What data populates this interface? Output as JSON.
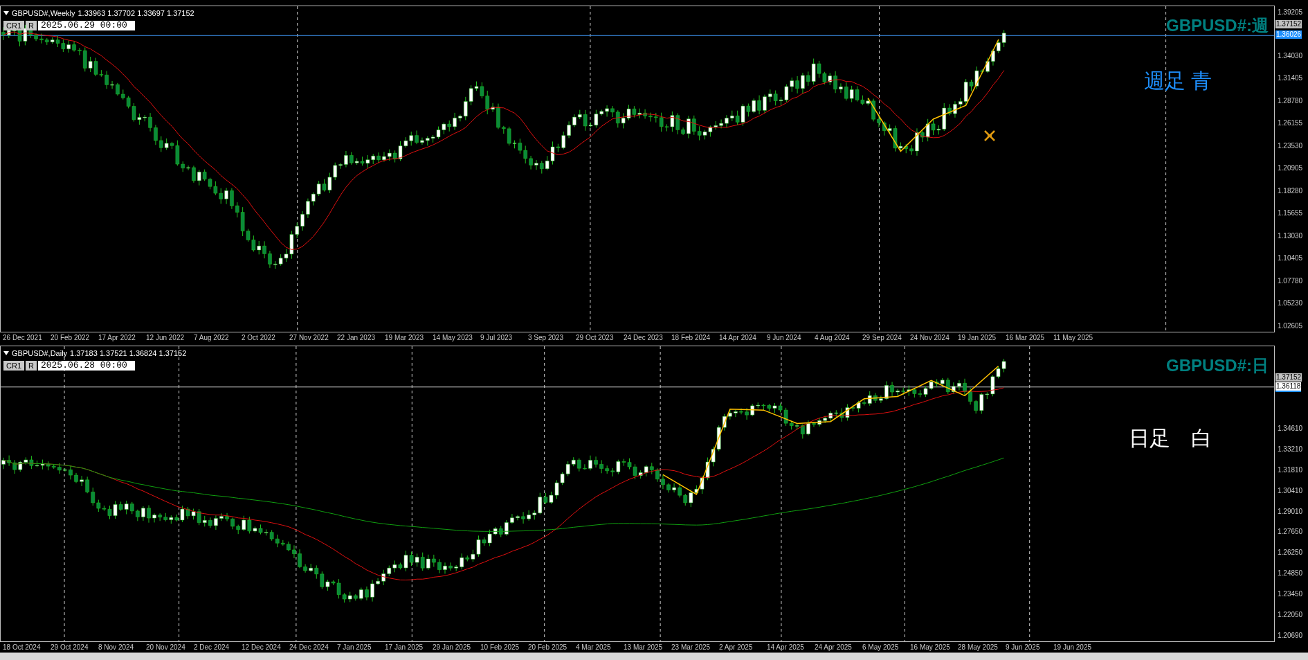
{
  "charts": [
    {
      "symbol": "GBPUSD#,Weekly",
      "ohlc": "1.33963 1.37702 1.33697 1.37152",
      "buttons": [
        "CR1",
        "R"
      ],
      "time_field": "2025.06.29 00:00",
      "label": "GBPUSD#:週",
      "note": {
        "text": "週足 青",
        "color": "#1e90ff"
      },
      "kind": "weekly",
      "price_axis": [
        "1.39205",
        "1.34030",
        "1.31405",
        "1.28780",
        "1.26155",
        "1.23530",
        "1.20905",
        "1.18280",
        "1.15655",
        "1.13030",
        "1.10405",
        "1.07780",
        "1.05230",
        "1.02605"
      ],
      "price_tags": [
        {
          "text": "1.37152",
          "kind": "bid"
        },
        {
          "text": "1.36026",
          "kind": "line"
        }
      ],
      "time_axis": [
        "26 Dec 2021",
        "20 Feb 2022",
        "17 Apr 2022",
        "12 Jun 2022",
        "7 Aug 2022",
        "2 Oct 2022",
        "27 Nov 2022",
        "22 Jan 2023",
        "19 Mar 2023",
        "14 May 2023",
        "9 Jul 2023",
        "3 Sep 2023",
        "29 Oct 2023",
        "24 Dec 2023",
        "18 Feb 2024",
        "14 Apr 2024",
        "9 Jun 2024",
        "4 Aug 2024",
        "29 Sep 2024",
        "24 Nov 2024",
        "19 Jan 2025",
        "16 Mar 2025",
        "11 May 2025"
      ]
    },
    {
      "symbol": "GBPUSD#,Daily",
      "ohlc": "1.37183 1.37521 1.36824 1.37152",
      "buttons": [
        "CR1",
        "R"
      ],
      "time_field": "2025.06.28 00:00",
      "label": "GBPUSD#:日",
      "note": {
        "text": "日足　白",
        "color": "#ffffff"
      },
      "kind": "daily",
      "price_axis": [
        "1.34610",
        "1.33210",
        "1.31810",
        "1.30410",
        "1.29010",
        "1.27650",
        "1.26250",
        "1.24850",
        "1.23450",
        "1.22050",
        "1.20690"
      ],
      "price_tags": [
        {
          "text": "1.37152",
          "kind": "bid"
        },
        {
          "text": "1.36118",
          "kind": "line"
        }
      ],
      "time_axis": [
        "18 Oct 2024",
        "29 Oct 2024",
        "8 Nov 2024",
        "20 Nov 2024",
        "2 Dec 2024",
        "12 Dec 2024",
        "24 Dec 2024",
        "7 Jan 2025",
        "17 Jan 2025",
        "29 Jan 2025",
        "10 Feb 2025",
        "20 Feb 2025",
        "4 Mar 2025",
        "13 Mar 2025",
        "23 Mar 2025",
        "2 Apr 2025",
        "14 Apr 2025",
        "24 Apr 2025",
        "6 May 2025",
        "16 May 2025",
        "28 May 2025",
        "9 Jun 2025",
        "19 Jun 2025"
      ]
    }
  ]
}
